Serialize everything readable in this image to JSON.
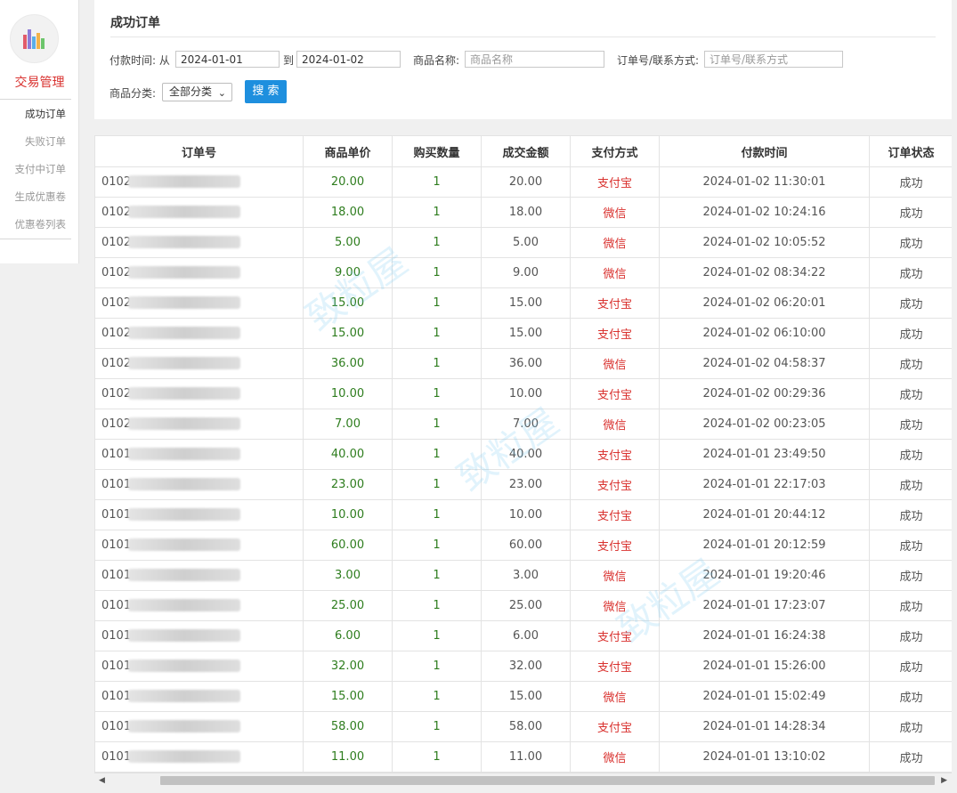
{
  "sidebar": {
    "title": "交易管理",
    "items": [
      {
        "label": "成功订单",
        "active": true
      },
      {
        "label": "失败订单",
        "active": false
      },
      {
        "label": "支付中订单",
        "active": false
      },
      {
        "label": "生成优惠卷",
        "active": false
      },
      {
        "label": "优惠卷列表",
        "active": false
      }
    ]
  },
  "search": {
    "title": "成功订单",
    "pay_time_label": "付款时间: 从",
    "date_from": "2024-01-01",
    "to_label": "到",
    "date_to": "2024-01-02",
    "product_name_label": "商品名称:",
    "product_name_placeholder": "商品名称",
    "order_label": "订单号/联系方式:",
    "order_placeholder": "订单号/联系方式",
    "category_label": "商品分类:",
    "category_value": "全部分类",
    "search_button": "搜 索"
  },
  "table": {
    "headers": [
      "订单号",
      "商品单价",
      "购买数量",
      "成交金额",
      "支付方式",
      "付款时间",
      "订单状态"
    ],
    "rows": [
      {
        "order": "0102",
        "price": "20.00",
        "qty": "1",
        "amount": "20.00",
        "pay": "支付宝",
        "time": "2024-01-02 11:30:01",
        "status": "成功"
      },
      {
        "order": "0102",
        "price": "18.00",
        "qty": "1",
        "amount": "18.00",
        "pay": "微信",
        "time": "2024-01-02 10:24:16",
        "status": "成功"
      },
      {
        "order": "0102",
        "price": "5.00",
        "qty": "1",
        "amount": "5.00",
        "pay": "微信",
        "time": "2024-01-02 10:05:52",
        "status": "成功"
      },
      {
        "order": "0102",
        "price": "9.00",
        "qty": "1",
        "amount": "9.00",
        "pay": "微信",
        "time": "2024-01-02 08:34:22",
        "status": "成功"
      },
      {
        "order": "0102",
        "price": "15.00",
        "qty": "1",
        "amount": "15.00",
        "pay": "支付宝",
        "time": "2024-01-02 06:20:01",
        "status": "成功"
      },
      {
        "order": "0102",
        "price": "15.00",
        "qty": "1",
        "amount": "15.00",
        "pay": "支付宝",
        "time": "2024-01-02 06:10:00",
        "status": "成功"
      },
      {
        "order": "0102",
        "price": "36.00",
        "qty": "1",
        "amount": "36.00",
        "pay": "微信",
        "time": "2024-01-02 04:58:37",
        "status": "成功"
      },
      {
        "order": "0102",
        "price": "10.00",
        "qty": "1",
        "amount": "10.00",
        "pay": "支付宝",
        "time": "2024-01-02 00:29:36",
        "status": "成功"
      },
      {
        "order": "0102",
        "price": "7.00",
        "qty": "1",
        "amount": "7.00",
        "pay": "微信",
        "time": "2024-01-02 00:23:05",
        "status": "成功"
      },
      {
        "order": "0101",
        "price": "40.00",
        "qty": "1",
        "amount": "40.00",
        "pay": "支付宝",
        "time": "2024-01-01 23:49:50",
        "status": "成功"
      },
      {
        "order": "0101",
        "price": "23.00",
        "qty": "1",
        "amount": "23.00",
        "pay": "支付宝",
        "time": "2024-01-01 22:17:03",
        "status": "成功"
      },
      {
        "order": "0101",
        "price": "10.00",
        "qty": "1",
        "amount": "10.00",
        "pay": "支付宝",
        "time": "2024-01-01 20:44:12",
        "status": "成功"
      },
      {
        "order": "0101",
        "price": "60.00",
        "qty": "1",
        "amount": "60.00",
        "pay": "支付宝",
        "time": "2024-01-01 20:12:59",
        "status": "成功"
      },
      {
        "order": "0101",
        "price": "3.00",
        "qty": "1",
        "amount": "3.00",
        "pay": "微信",
        "time": "2024-01-01 19:20:46",
        "status": "成功"
      },
      {
        "order": "0101",
        "price": "25.00",
        "qty": "1",
        "amount": "25.00",
        "pay": "微信",
        "time": "2024-01-01 17:23:07",
        "status": "成功"
      },
      {
        "order": "0101",
        "price": "6.00",
        "qty": "1",
        "amount": "6.00",
        "pay": "支付宝",
        "time": "2024-01-01 16:24:38",
        "status": "成功"
      },
      {
        "order": "0101",
        "price": "32.00",
        "qty": "1",
        "amount": "32.00",
        "pay": "支付宝",
        "time": "2024-01-01 15:26:00",
        "status": "成功"
      },
      {
        "order": "0101",
        "price": "15.00",
        "qty": "1",
        "amount": "15.00",
        "pay": "微信",
        "time": "2024-01-01 15:02:49",
        "status": "成功"
      },
      {
        "order": "0101",
        "price": "58.00",
        "qty": "1",
        "amount": "58.00",
        "pay": "支付宝",
        "time": "2024-01-01 14:28:34",
        "status": "成功"
      },
      {
        "order": "0101",
        "price": "11.00",
        "qty": "1",
        "amount": "11.00",
        "pay": "微信",
        "time": "2024-01-01 13:10:02",
        "status": "成功"
      }
    ]
  },
  "watermark_text": "致粒屋",
  "colors": {
    "accent_red": "#d9322f",
    "price_green": "#2e7d1e",
    "button_blue": "#1e8fde"
  }
}
